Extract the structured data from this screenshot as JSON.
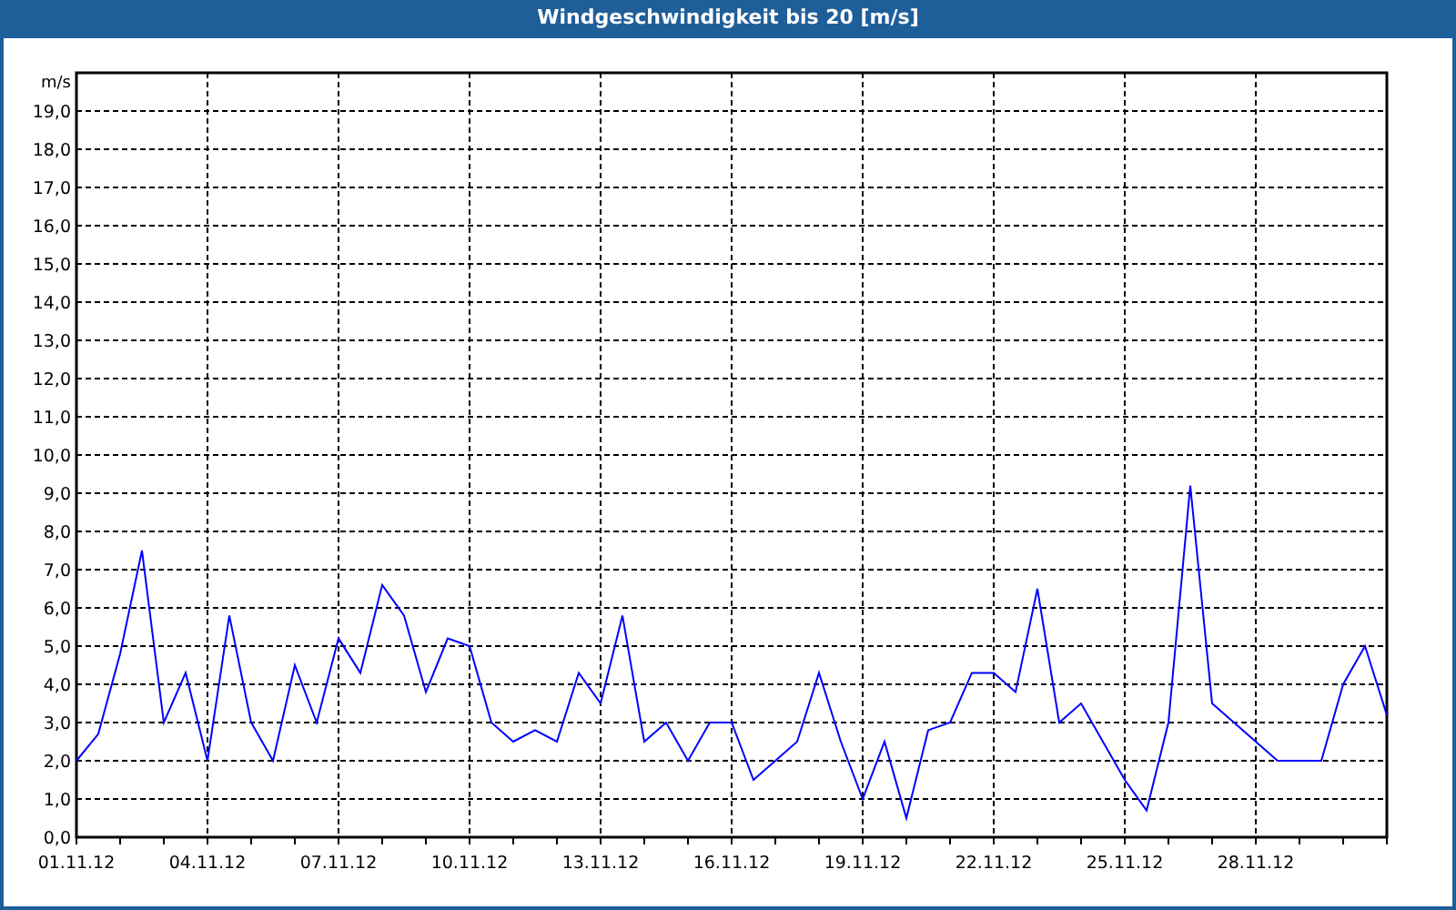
{
  "window": {
    "title": "Windgeschwindigkeit bis 20 [m/s]"
  },
  "chart": {
    "chart_data": {
      "type": "line",
      "grid": true,
      "ylabel": "m/s",
      "ylim": [
        0,
        20
      ],
      "categories": [
        "01.11.12",
        null,
        null,
        null,
        null,
        null,
        "04.11.12",
        null,
        null,
        null,
        null,
        null,
        "07.11.12",
        null,
        null,
        null,
        null,
        null,
        "10.11.12",
        null,
        null,
        null,
        null,
        null,
        "13.11.12",
        null,
        null,
        null,
        null,
        null,
        "16.11.12",
        null,
        null,
        null,
        null,
        null,
        "19.11.12",
        null,
        null,
        null,
        null,
        null,
        "22.11.12",
        null,
        null,
        null,
        null,
        null,
        "25.11.12",
        null,
        null,
        null,
        null,
        null,
        "28.11.12",
        null,
        null,
        null,
        null,
        null,
        null
      ],
      "series": [
        {
          "color": "#0000ff",
          "values": [
            2.0,
            2.7,
            4.8,
            7.5,
            3.0,
            4.3,
            2.0,
            5.8,
            3.0,
            2.0,
            4.5,
            3.0,
            5.2,
            4.3,
            6.6,
            5.8,
            3.8,
            5.2,
            5.0,
            3.0,
            2.5,
            2.8,
            2.5,
            4.3,
            3.5,
            5.8,
            2.5,
            3.0,
            2.0,
            3.0,
            3.0,
            1.5,
            2.0,
            2.5,
            4.3,
            2.5,
            1.0,
            2.5,
            0.5,
            2.8,
            3.0,
            4.3,
            4.3,
            3.8,
            6.5,
            3.0,
            3.5,
            2.5,
            1.5,
            0.7,
            3.0,
            9.2,
            3.5,
            3.0,
            2.5,
            2.0,
            2.0,
            2.0,
            4.0,
            5.0,
            3.2
          ]
        }
      ],
      "yticks": [
        {
          "value": 0,
          "label": "0,0"
        },
        {
          "value": 1,
          "label": "1,0"
        },
        {
          "value": 2,
          "label": "2,0"
        },
        {
          "value": 3,
          "label": "3,0"
        },
        {
          "value": 4,
          "label": "4,0"
        },
        {
          "value": 5,
          "label": "5,0"
        },
        {
          "value": 6,
          "label": "6,0"
        },
        {
          "value": 7,
          "label": "7,0"
        },
        {
          "value": 8,
          "label": "8,0"
        },
        {
          "value": 9,
          "label": "9,0"
        },
        {
          "value": 10,
          "label": "10,0"
        },
        {
          "value": 11,
          "label": "11,0"
        },
        {
          "value": 12,
          "label": "12,0"
        },
        {
          "value": 13,
          "label": "13,0"
        },
        {
          "value": 14,
          "label": "14,0"
        },
        {
          "value": 15,
          "label": "15,0"
        },
        {
          "value": 16,
          "label": "16,0"
        },
        {
          "value": 17,
          "label": "17,0"
        },
        {
          "value": 18,
          "label": "18,0"
        },
        {
          "value": 19,
          "label": "19,0"
        }
      ]
    }
  }
}
